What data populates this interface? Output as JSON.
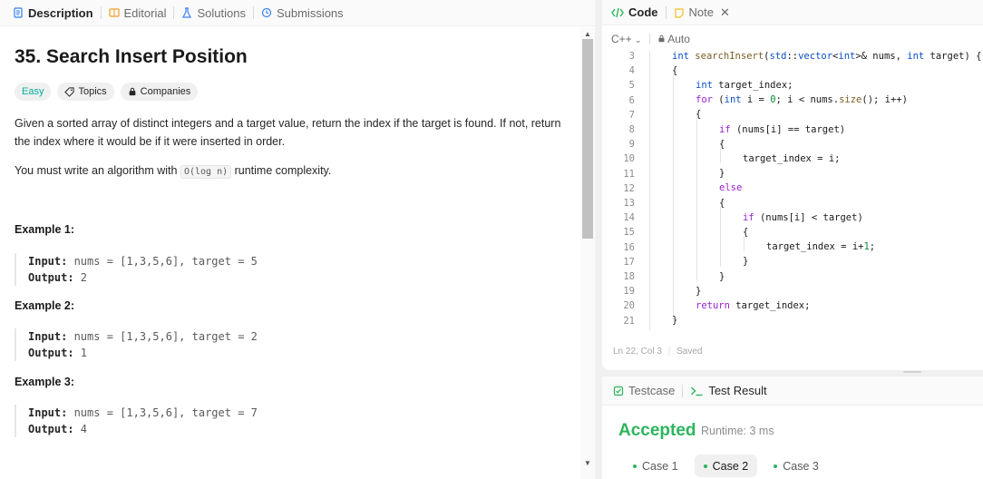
{
  "left_tabs": [
    {
      "label": "Description",
      "icon": "description-icon"
    },
    {
      "label": "Editorial",
      "icon": "book-icon"
    },
    {
      "label": "Solutions",
      "icon": "flask-icon"
    },
    {
      "label": "Submissions",
      "icon": "history-icon"
    }
  ],
  "problem": {
    "title": "35. Search Insert Position",
    "difficulty": "Easy",
    "topics_label": "Topics",
    "companies_label": "Companies",
    "desc1": "Given a sorted array of distinct integers and a target value, return the index if the target is found. If not, return the index where it would be if it were inserted in order.",
    "desc2_pre": "You must write an algorithm with ",
    "desc2_code": "O(log n)",
    "desc2_post": " runtime complexity.",
    "examples": [
      {
        "heading": "Example 1:",
        "input_label": "Input:",
        "input": " nums = [1,3,5,6], target = 5",
        "output_label": "Output:",
        "output": " 2"
      },
      {
        "heading": "Example 2:",
        "input_label": "Input:",
        "input": " nums = [1,3,5,6], target = 2",
        "output_label": "Output:",
        "output": " 1"
      },
      {
        "heading": "Example 3:",
        "input_label": "Input:",
        "input": " nums = [1,3,5,6], target = 7",
        "output_label": "Output:",
        "output": " 4"
      }
    ]
  },
  "code_tabs": {
    "code_label": "Code",
    "note_label": "Note"
  },
  "editor": {
    "language": "C++",
    "mode": "Auto",
    "line_numbers": [
      "3",
      "4",
      "5",
      "6",
      "7",
      "8",
      "9",
      "10",
      "11",
      "12",
      "13",
      "14",
      "15",
      "16",
      "17",
      "18",
      "19",
      "20",
      "21"
    ],
    "status_pos": "Ln 22, Col 3",
    "status_saved": "Saved"
  },
  "result": {
    "testcase_label": "Testcase",
    "testresult_label": "Test Result",
    "verdict": "Accepted",
    "runtime": "Runtime: 3 ms",
    "cases": [
      "Case 1",
      "Case 2",
      "Case 3"
    ],
    "selected_case": "Case 2"
  },
  "colors": {
    "accepted": "#2db55d",
    "easy": "#00af9b",
    "keyword": "#9b1fd0",
    "type": "#0a4fc7"
  }
}
